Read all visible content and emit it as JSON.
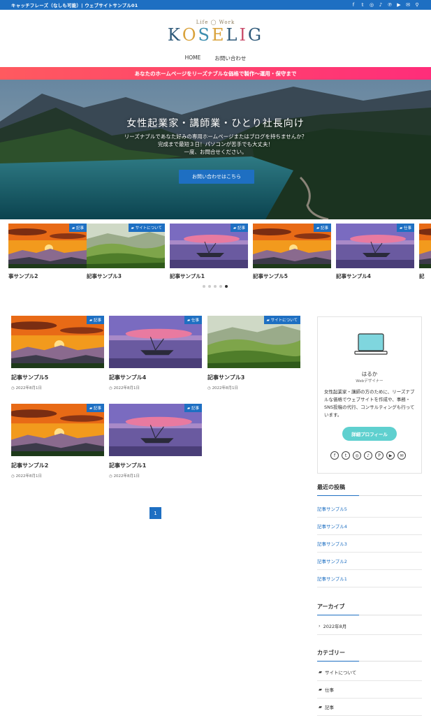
{
  "topbar": {
    "tagline": "キャッチフレーズ（なしも可能）| ウェブサイトサンプル01",
    "icons": [
      "facebook-icon",
      "twitter-icon",
      "instagram-icon",
      "tiktok-icon",
      "pinterest-icon",
      "youtube-icon",
      "mail-icon",
      "search-icon"
    ]
  },
  "header": {
    "logo_sub": "Life ◯ Work",
    "logo_letters": [
      "K",
      "O",
      "S",
      "E",
      "L",
      "I",
      "G"
    ],
    "logo_colors": [
      "#2f5a7a",
      "#d9a23b",
      "#3d8fb0",
      "#d9a23b",
      "#2f5a7a",
      "#c94d6b",
      "#2f5a7a"
    ]
  },
  "nav": {
    "items": [
      "HOME",
      "お問い合わせ"
    ]
  },
  "banner": {
    "text": "あなたのホームページをリーズナブルな価格で製作〜運用・保守まで"
  },
  "hero": {
    "title": "女性起業家・講師業・ひとり社長向け",
    "lead1": "リーズナブルであなた好みの専用ホームページまたはブログを持ちませんか？",
    "lead2": "完成まで最短３日！パソコンが苦手でも大丈夫！",
    "lead3": "一度、お問合せください。",
    "cta": "お問い合わせはこちら"
  },
  "slider": {
    "slides": [
      {
        "title": "事サンプル2",
        "badge": "記事",
        "img": "sunset"
      },
      {
        "title": "記事サンプル3",
        "badge": "サイトについて",
        "img": "meadow"
      },
      {
        "title": "記事サンプル1",
        "badge": "記事",
        "img": "boat"
      },
      {
        "title": "記事サンプル5",
        "badge": "記事",
        "img": "sunset"
      },
      {
        "title": "記事サンプル4",
        "badge": "仕事",
        "img": "boat"
      },
      {
        "title": "記",
        "badge": "",
        "img": "sunset"
      }
    ],
    "active_dot": 4,
    "dot_count": 5
  },
  "posts": [
    {
      "title": "記事サンプル5",
      "date": "2022年8月1日",
      "badge": "記事",
      "img": "sunset"
    },
    {
      "title": "記事サンプル4",
      "date": "2022年8月1日",
      "badge": "仕事",
      "img": "boat"
    },
    {
      "title": "記事サンプル3",
      "date": "2022年8月1日",
      "badge": "サイトについて",
      "img": "meadow"
    },
    {
      "title": "記事サンプル2",
      "date": "2022年8月1日",
      "badge": "記事",
      "img": "sunset"
    },
    {
      "title": "記事サンプル1",
      "date": "2022年8月1日",
      "badge": "記事",
      "img": "boat"
    }
  ],
  "pager": {
    "current": "1"
  },
  "profile": {
    "name": "はるか",
    "role": "Webデザイナー",
    "bio": "女性起業家・講師の方のために、リーズナブルな価格でウェブサイトを作成や、事務・SNS投稿の代行、コンサルティングも行っています。",
    "button": "詳細プロフィール",
    "social": [
      "f",
      "t",
      "◎",
      "♪",
      "P",
      "▶",
      "✉"
    ]
  },
  "recent": {
    "title": "最近の投稿",
    "items": [
      "記事サンプル5",
      "記事サンプル4",
      "記事サンプル3",
      "記事サンプル2",
      "記事サンプル1"
    ]
  },
  "archive": {
    "title": "アーカイブ",
    "items": [
      "2022年8月"
    ]
  },
  "category": {
    "title": "カテゴリー",
    "items": [
      "サイトについて",
      "仕事",
      "記事"
    ]
  },
  "colors": {
    "primary": "#1e6fc2",
    "accent": "#5fd0cf",
    "banner_from": "#ff5a5f",
    "banner_to": "#ff2d7a"
  }
}
